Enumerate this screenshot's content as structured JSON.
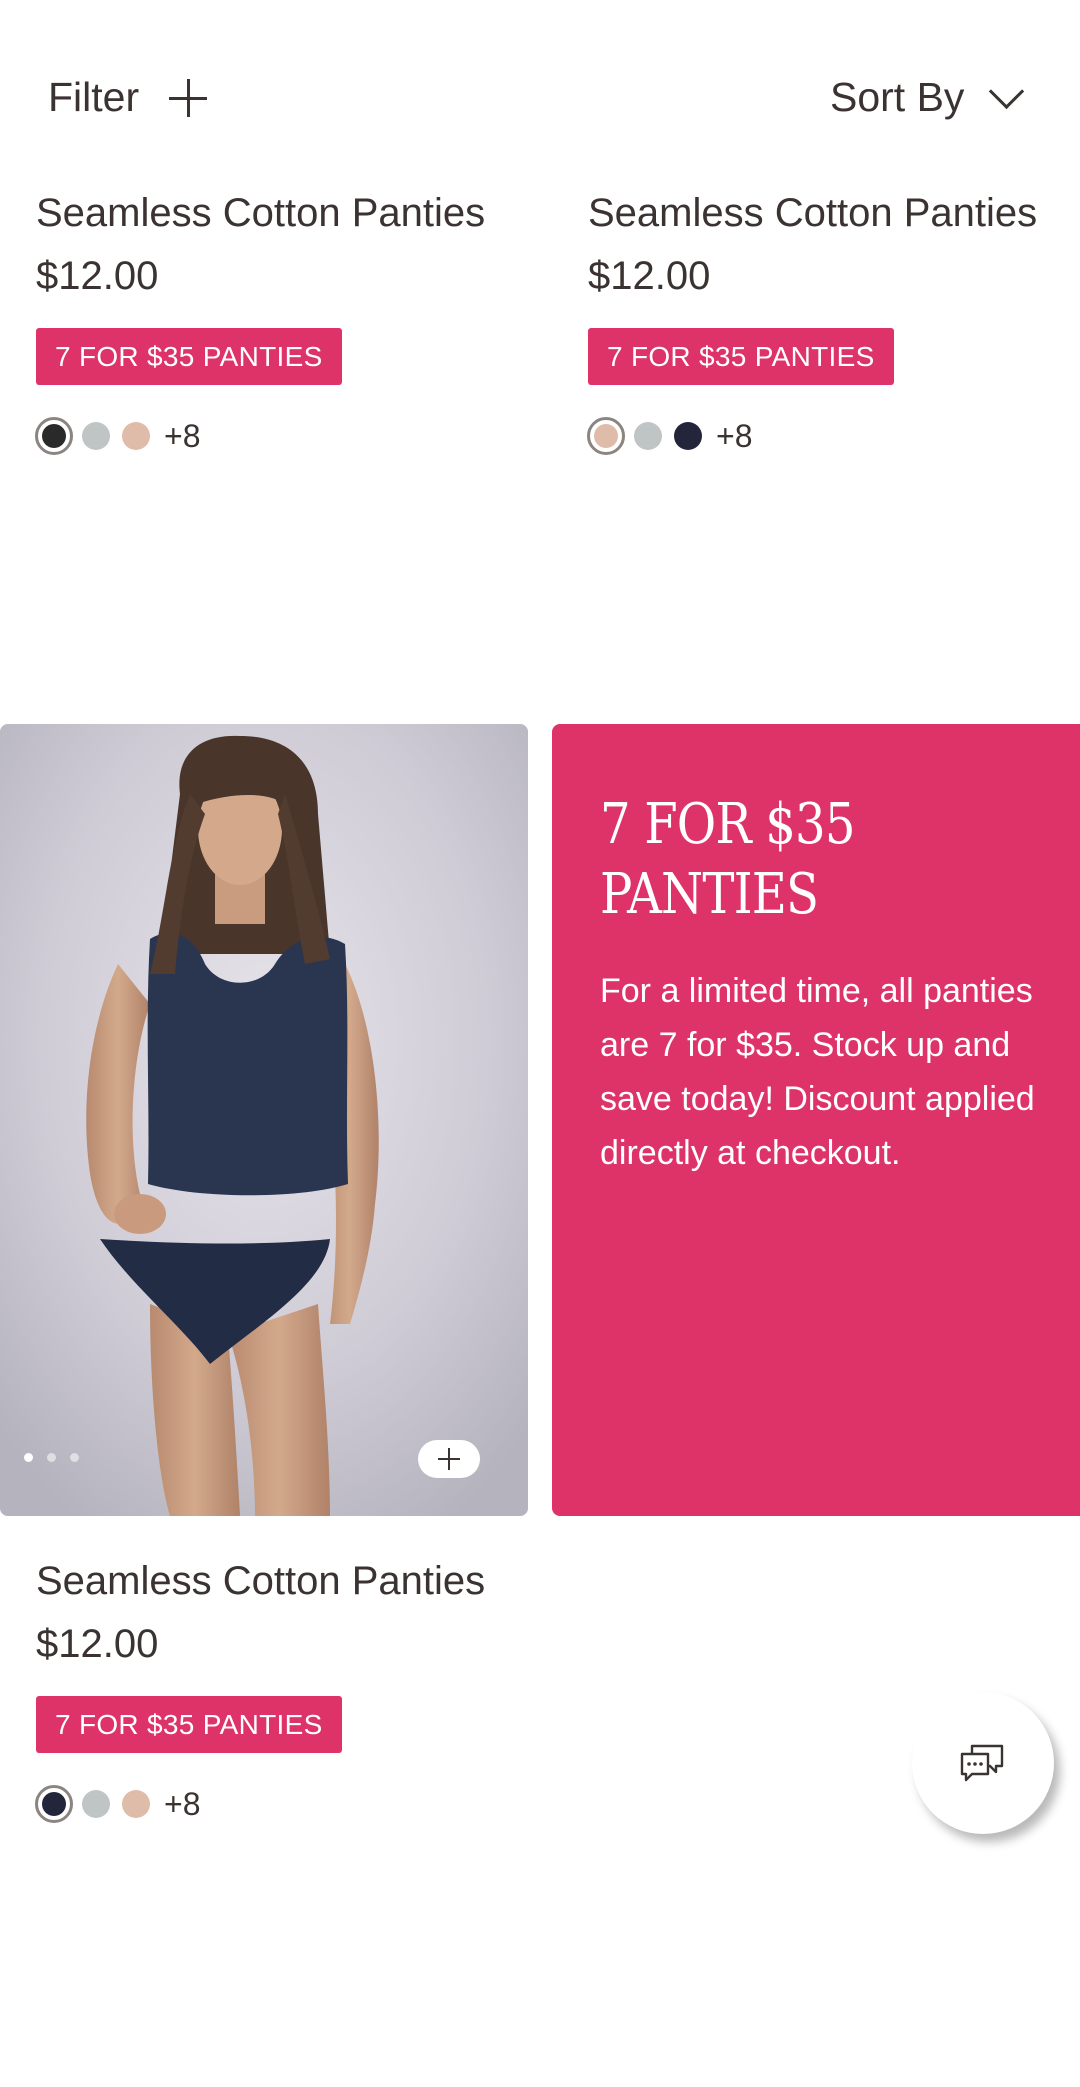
{
  "toolbar": {
    "filter_label": "Filter",
    "sort_label": "Sort By"
  },
  "products": [
    {
      "name": "Seamless Cotton Panties",
      "price": "$12.00",
      "badge": "7 FOR $35 PANTIES",
      "swatches": [
        "#2b2a2a",
        "#bfc4c4",
        "#dfbba9"
      ],
      "selected_swatch": 0,
      "more_colors": "+8"
    },
    {
      "name": "Seamless Cotton Panties",
      "price": "$12.00",
      "badge": "7 FOR $35 PANTIES",
      "swatches": [
        "#dfbba9",
        "#bfc4c4",
        "#23253a"
      ],
      "selected_swatch": 0,
      "more_colors": "+8"
    },
    {
      "name": "Seamless Cotton Panties",
      "price": "$12.00",
      "badge": "7 FOR $35 PANTIES",
      "swatches": [
        "#23253a",
        "#bfc4c4",
        "#dfbba9"
      ],
      "selected_swatch": 0,
      "more_colors": "+8",
      "image_dots": 3,
      "active_dot": 0
    }
  ],
  "promo": {
    "title_line1": "7 FOR $35",
    "title_line2": "PANTIES",
    "body": "For a limited time, all panties are 7 for $35. Stock up and save today! Discount applied directly at checkout."
  },
  "colors": {
    "accent": "#de3369",
    "text": "#3b3331"
  },
  "icons": {
    "filter": "plus-icon",
    "sort": "chevron-down-icon",
    "quick_add": "plus-icon",
    "chat": "chat-bubbles-icon"
  }
}
